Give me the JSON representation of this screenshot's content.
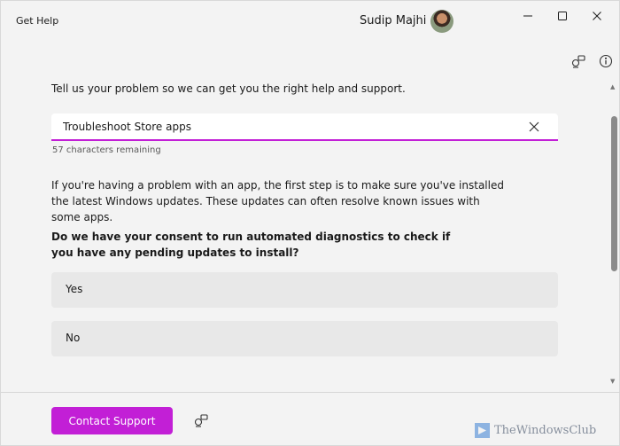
{
  "window": {
    "title": "Get Help",
    "user_name": "Sudip Majhi"
  },
  "main": {
    "prompt": "Tell us your problem so we can get you the right help and support.",
    "search": {
      "value": "Troubleshoot Store apps",
      "chars_remaining": "57 characters remaining"
    },
    "description": "If you're having a problem with an app, the first step is to make sure you've installed the latest Windows updates. These updates can often resolve known issues with some apps.",
    "consent_question": "Do we have your consent to run automated diagnostics to check if you have any pending updates to install?",
    "options": [
      {
        "label": "Yes"
      },
      {
        "label": "No"
      }
    ]
  },
  "footer": {
    "contact_label": "Contact Support"
  },
  "watermark": {
    "text": "TheWindowsClub"
  },
  "colors": {
    "accent": "#c21fd6",
    "background": "#f3f3f3",
    "option_bg": "#e8e8e8"
  },
  "icons": [
    "avatar",
    "minimize-icon",
    "maximize-icon",
    "close-icon",
    "feedback-icon",
    "info-icon",
    "clear-icon"
  ]
}
